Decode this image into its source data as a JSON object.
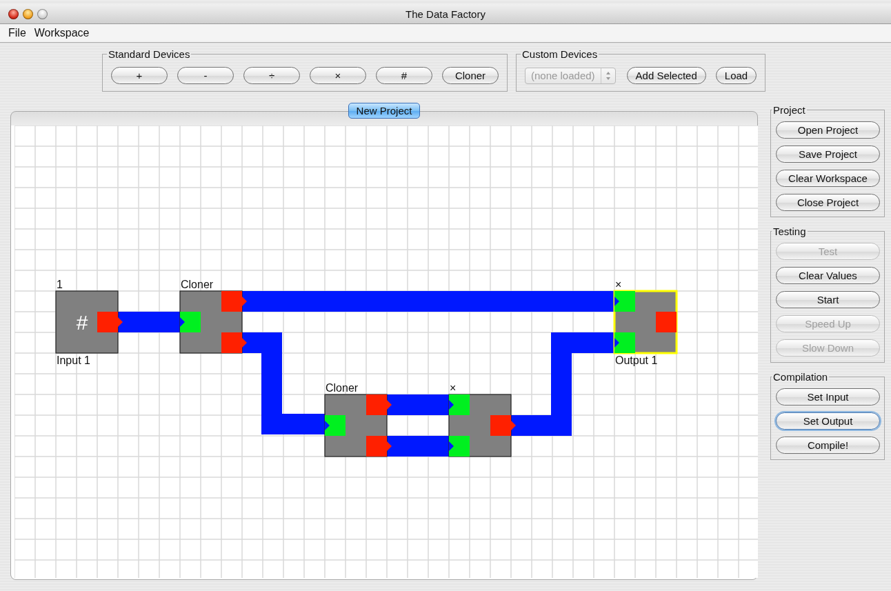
{
  "window": {
    "title": "The Data Factory"
  },
  "menu": [
    "File",
    "Workspace"
  ],
  "standard_devices": {
    "title": "Standard Devices",
    "buttons": [
      "+",
      "-",
      "÷",
      "×",
      "#",
      "Cloner"
    ]
  },
  "custom_devices": {
    "title": "Custom Devices",
    "selector": {
      "value": "(none loaded)",
      "disabled": true
    },
    "buttons": [
      "Add Selected",
      "Load"
    ]
  },
  "tabs": [
    {
      "label": "New Project",
      "selected": true
    }
  ],
  "devices": [
    {
      "kind": "input",
      "top_label": "1",
      "symbol": "#",
      "bottom_label": "Input 1",
      "selected": false
    },
    {
      "kind": "cloner",
      "top_label": "Cloner",
      "selected": false
    },
    {
      "kind": "cloner",
      "top_label": "Cloner",
      "selected": false
    },
    {
      "kind": "operator",
      "top_label": "×",
      "selected": false
    },
    {
      "kind": "output",
      "top_label": "×",
      "bottom_label": "Output 1",
      "selected": true
    }
  ],
  "side_panels": [
    {
      "title": "Project",
      "buttons": [
        {
          "label": "Open Project",
          "disabled": false,
          "focused": false
        },
        {
          "label": "Save Project",
          "disabled": false,
          "focused": false
        },
        {
          "label": "Clear Workspace",
          "disabled": false,
          "focused": false
        },
        {
          "label": "Close Project",
          "disabled": false,
          "focused": false
        }
      ]
    },
    {
      "title": "Testing",
      "buttons": [
        {
          "label": "Test",
          "disabled": true,
          "focused": false
        },
        {
          "label": "Clear Values",
          "disabled": false,
          "focused": false
        },
        {
          "label": "Start",
          "disabled": false,
          "focused": false
        },
        {
          "label": "Speed Up",
          "disabled": true,
          "focused": false
        },
        {
          "label": "Slow Down",
          "disabled": true,
          "focused": false
        }
      ]
    },
    {
      "title": "Compilation",
      "buttons": [
        {
          "label": "Set Input",
          "disabled": false,
          "focused": false
        },
        {
          "label": "Set Output",
          "disabled": false,
          "focused": true
        },
        {
          "label": "Compile!",
          "disabled": false,
          "focused": false
        }
      ]
    }
  ]
}
